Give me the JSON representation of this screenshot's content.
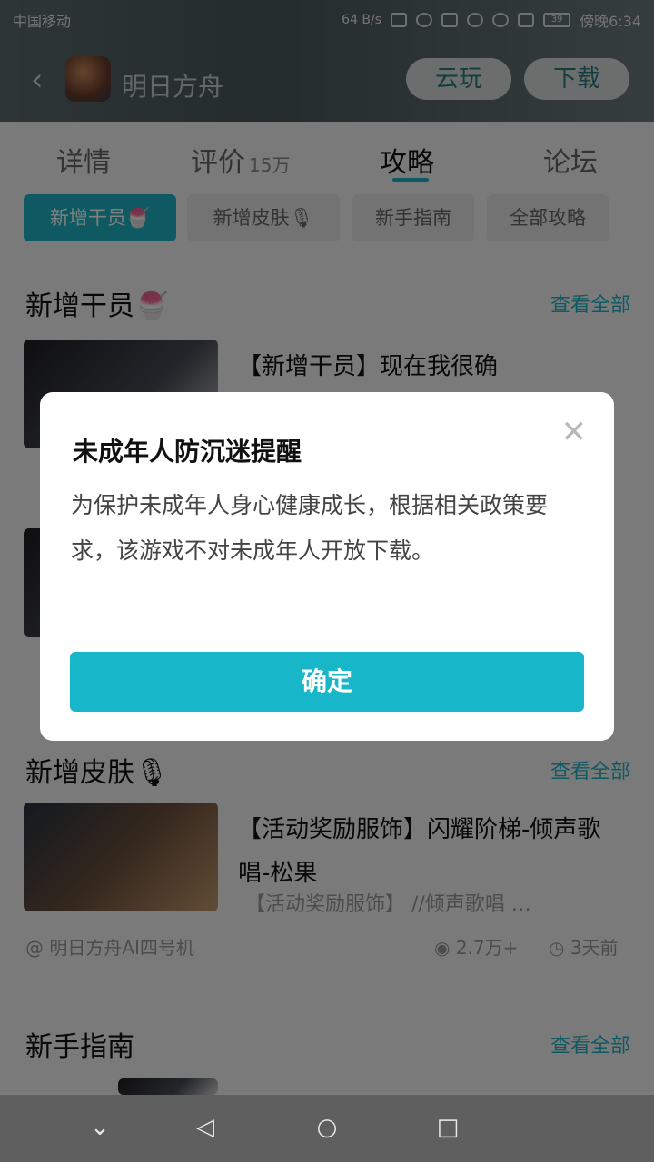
{
  "status_bar": {
    "carrier": "中国移动",
    "net_speed": "64 B/s",
    "battery": "39",
    "time": "傍晚6:34"
  },
  "header": {
    "app_name": "明日方舟",
    "cloud_play": "云玩",
    "download": "下载"
  },
  "tabs": [
    {
      "label": "详情"
    },
    {
      "label": "评价",
      "count": "15万"
    },
    {
      "label": "攻略"
    },
    {
      "label": "论坛"
    }
  ],
  "chips": [
    "新增干员🍧",
    "新增皮肤🎙",
    "新手指南",
    "全部攻略"
  ],
  "sections": {
    "operators": {
      "title": "新增干员🍧",
      "more": "查看全部",
      "article_title": "【新增干员】现在我很确"
    },
    "skins": {
      "title": "新增皮肤🎙",
      "more": "查看全部",
      "article_title": "【活动奖励服饰】闪耀阶梯-倾声歌唱-松果",
      "article_sub": "【活动奖励服饰】 //倾声歌唱 …",
      "author": "@ 明日方舟AI四号机",
      "views": "2.7万+",
      "time_ago": "3天前"
    },
    "guide": {
      "title": "新手指南",
      "more": "查看全部"
    }
  },
  "dialog": {
    "title": "未成年人防沉迷提醒",
    "body": "为保护未成年人身心健康成长，根据相关政策要求，该游戏不对未成年人开放下载。",
    "confirm": "确定",
    "close_symbol": "✕"
  },
  "navbar": {
    "back_symbol": "◁",
    "home_symbol": "○",
    "recents_symbol": "□",
    "collapse_symbol": "⌄"
  },
  "colors": {
    "accent": "#1fb4c4",
    "confirm": "#17b6c8",
    "header_bg": "#5d6b6e"
  }
}
